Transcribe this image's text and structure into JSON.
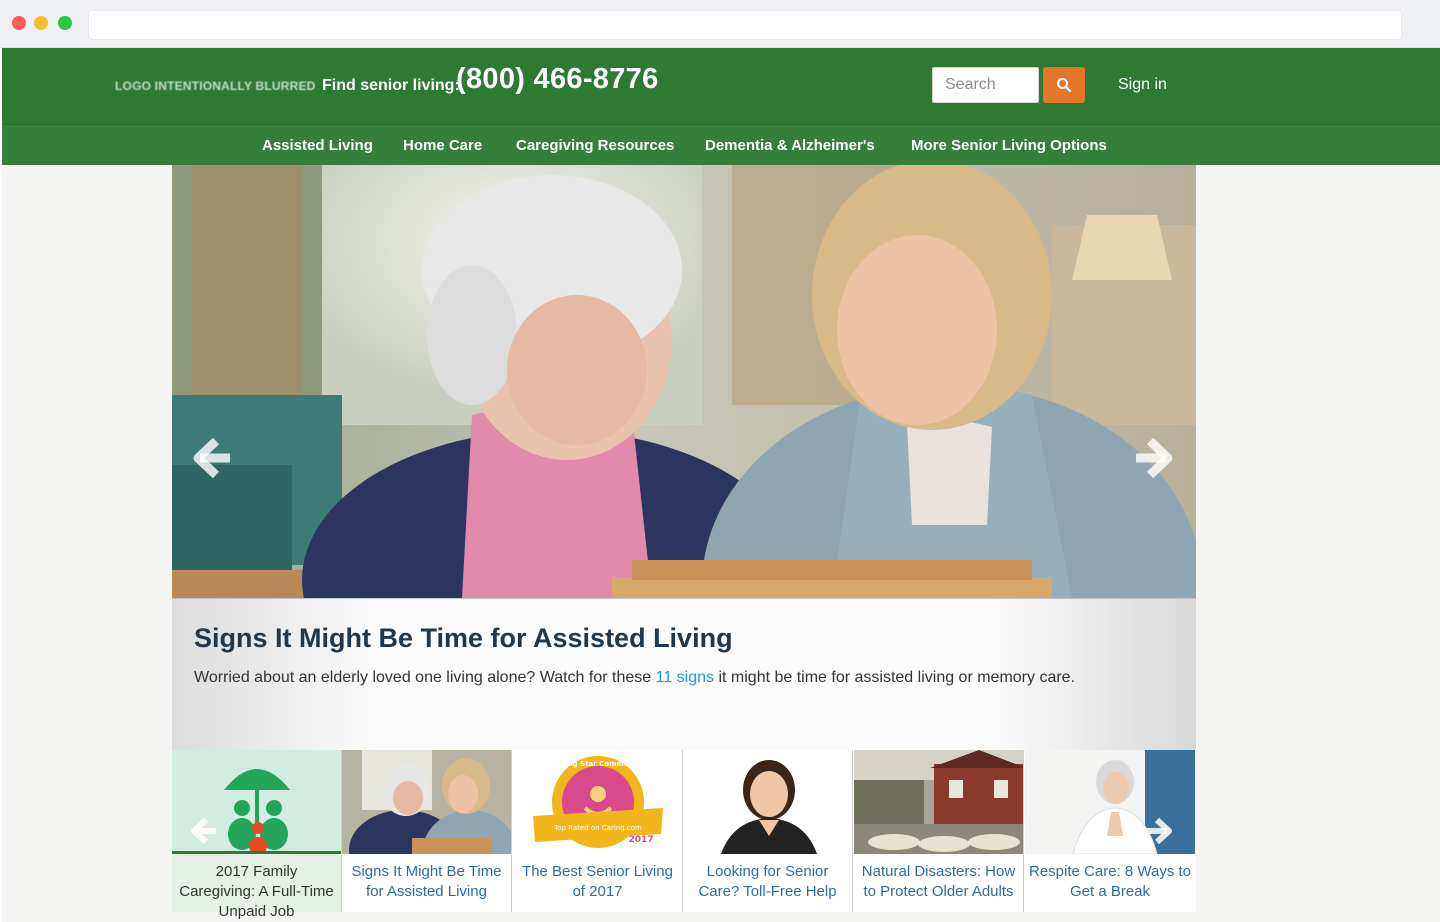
{
  "header": {
    "logo_text": "LOGO INTENTIONALLY BLURRED",
    "find_label": "Find senior living:",
    "phone": "(800) 466-8776",
    "search_placeholder": "Search",
    "signin_label": "Sign in",
    "brand_color": "#2e7a33",
    "search_button_color": "#e3762a"
  },
  "nav": {
    "items": [
      {
        "label": "Assisted Living"
      },
      {
        "label": "Home Care"
      },
      {
        "label": "Caregiving Resources"
      },
      {
        "label": "Dementia & Alzheimer's"
      },
      {
        "label": "More Senior Living Options"
      }
    ]
  },
  "hero": {
    "prev_icon": "chevron-left-icon",
    "next_icon": "chevron-right-icon"
  },
  "feature": {
    "title": "Signs It Might Be Time for Assisted Living",
    "text_before": "Worried about an elderly loved one living alone? Watch for these ",
    "link_text": "11 signs",
    "text_after": " it might be time for assisted living or memory care."
  },
  "thumbnails": [
    {
      "label": "2017 Family Caregiving: A Full-Time Unpaid Job",
      "icon": "umbrella-family-icon"
    },
    {
      "label": "Signs It Might Be Time for Assisted Living",
      "icon": "photo"
    },
    {
      "label": "The Best Senior Living of 2017",
      "icon": "caring-star-badge"
    },
    {
      "label": "Looking for Senior Care? Toll-Free Help",
      "icon": "photo"
    },
    {
      "label": "Natural Disasters: How to Protect Older Adults",
      "icon": "photo"
    },
    {
      "label": "Respite Care: 8 Ways to Get a Break",
      "icon": "photo"
    }
  ],
  "badge": {
    "line1": "Caring Star Community",
    "line2": "Top Rated on Caring.com",
    "year": "2017"
  }
}
